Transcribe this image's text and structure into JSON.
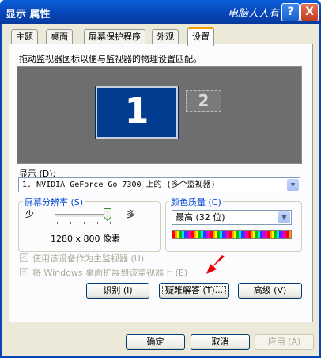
{
  "window": {
    "title": "显示 属性",
    "watermark": "电脑人人有",
    "help_label": "?",
    "close_label": "X"
  },
  "tabs": [
    {
      "label": "主题"
    },
    {
      "label": "桌面"
    },
    {
      "label": "屏幕保护程序"
    },
    {
      "label": "外观"
    },
    {
      "label": "设置",
      "active": true
    }
  ],
  "settings": {
    "instruction": "拖动监视器图标以便与监视器的物理设置匹配。",
    "monitors": [
      {
        "number": "1",
        "primary": true
      },
      {
        "number": "2",
        "primary": false
      }
    ],
    "display_label": "显示 (D):",
    "display_value": "1. NVIDIA GeForce Go 7300 上的 (多个监视器)",
    "resolution": {
      "group_label": "屏幕分辨率 (S)",
      "less_label": "少",
      "more_label": "多",
      "value": "1280 x 800 像素",
      "slider_level_fraction": 0.9
    },
    "color_quality": {
      "group_label": "颜色质量 (C)",
      "value": "最高 (32 位)"
    },
    "checkboxes": [
      {
        "label": "使用该设备作为主监视器 (U)",
        "checked": true,
        "enabled": false
      },
      {
        "label": "将 Windows 桌面扩展到该监视器上 (E)",
        "checked": true,
        "enabled": false
      }
    ],
    "buttons": {
      "identify": "识别 (I)",
      "troubleshoot": "疑难解答 (T)...",
      "advanced": "高级 (V)"
    }
  },
  "footer": {
    "ok": "确定",
    "cancel": "取消",
    "apply": "应用 (A)"
  },
  "colors": {
    "titlebar": "#0846b8",
    "dialog_bg": "#ece9d8",
    "monitor_area": "#6e6e6e",
    "monitor_primary": "#003c8f",
    "group_label": "#0046d5",
    "arrow": "#e60000"
  }
}
